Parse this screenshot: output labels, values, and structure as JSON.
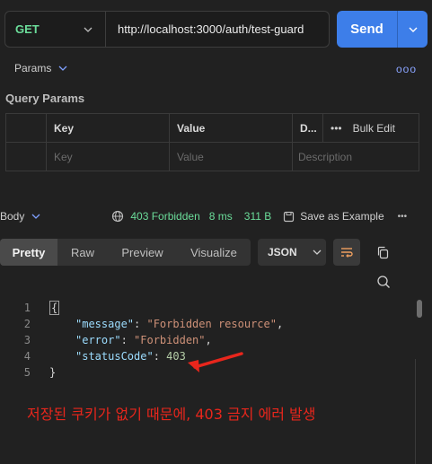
{
  "request": {
    "method": "GET",
    "url": "http://localhost:3000/auth/test-guard",
    "send_label": "Send"
  },
  "tabs": {
    "params_label": "Params",
    "more": "ooo"
  },
  "query_params": {
    "title": "Query Params",
    "headers": [
      "Key",
      "Value",
      "D...",
      "Bulk Edit"
    ],
    "placeholders": [
      "Key",
      "Value",
      "Description"
    ],
    "more": "•••"
  },
  "response": {
    "body_label": "Body",
    "status": "403 Forbidden",
    "time": "8 ms",
    "size": "311 B",
    "save_label": "Save as Example",
    "more": "•••"
  },
  "format_tabs": [
    "Pretty",
    "Raw",
    "Preview",
    "Visualize"
  ],
  "format_select": "JSON",
  "code_lines": [
    {
      "n": "1",
      "text": "{"
    },
    {
      "n": "2",
      "key": "\"message\"",
      "value": "\"Forbidden resource\"",
      "trail": ","
    },
    {
      "n": "3",
      "key": "\"error\"",
      "value": "\"Forbidden\"",
      "trail": ","
    },
    {
      "n": "4",
      "key": "\"statusCode\"",
      "value": "403",
      "trail": ""
    },
    {
      "n": "5",
      "text": "}"
    }
  ],
  "annotation": "저장된 쿠키가 없기 때문에, 403 금지 에러 발생",
  "colors": {
    "accent": "#3d7ee9",
    "success": "#6bdd9a",
    "annotation": "#e8261c"
  }
}
